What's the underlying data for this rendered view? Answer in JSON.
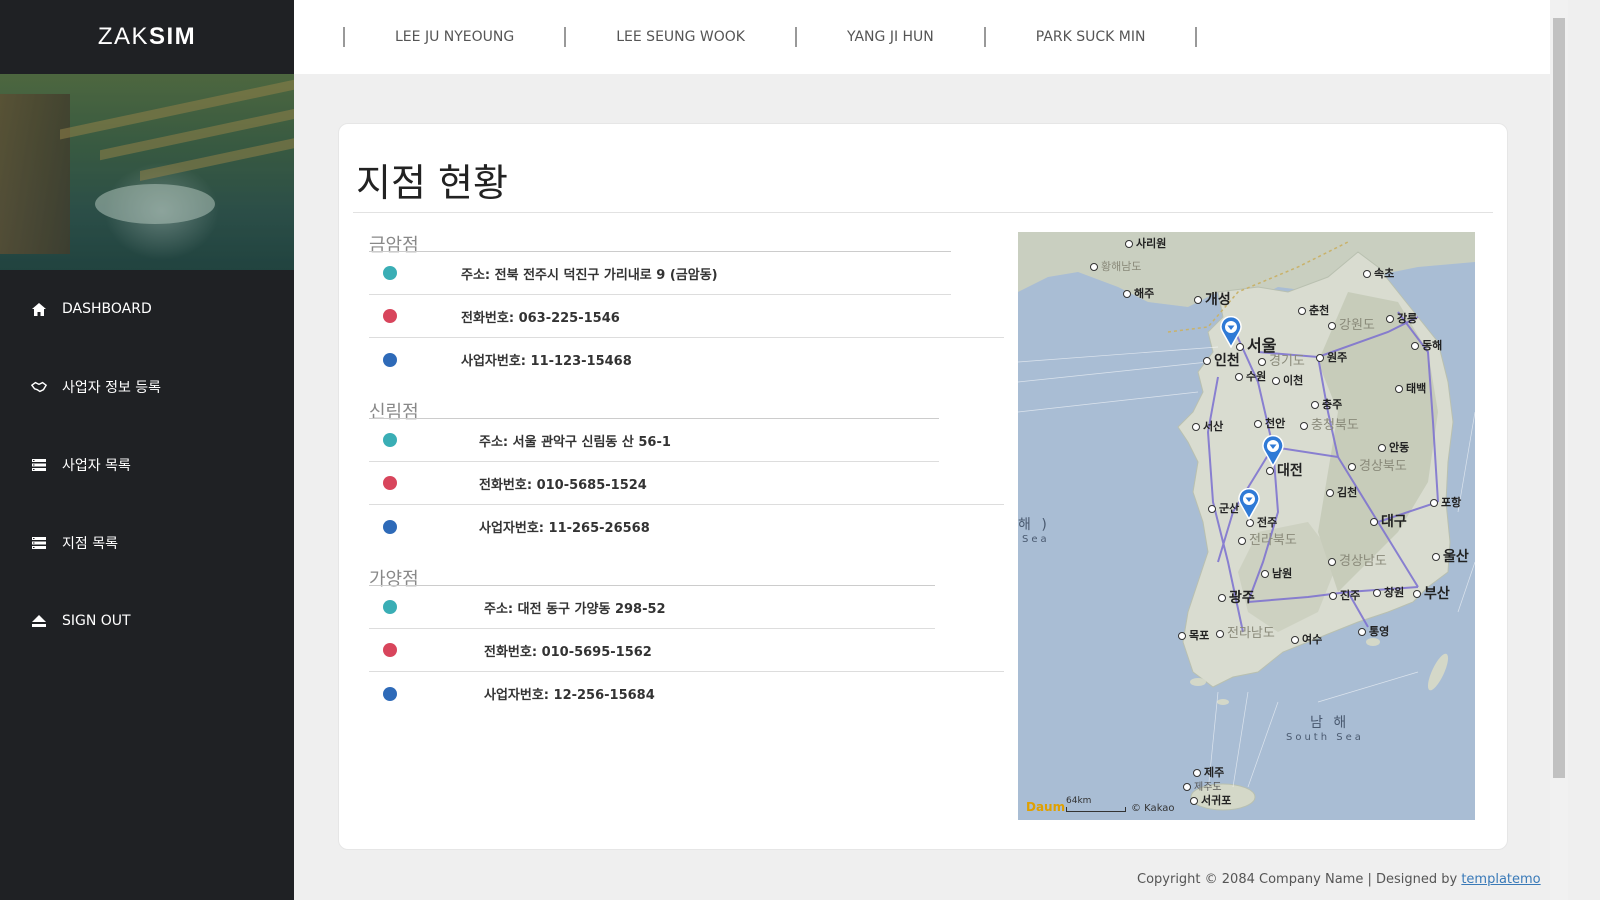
{
  "brand": {
    "light": "ZAK",
    "bold": "SIM"
  },
  "sidebar": {
    "items": [
      {
        "label": "DASHBOARD",
        "icon": "home-icon"
      },
      {
        "label": "사업자 정보 등록",
        "icon": "handshake-icon"
      },
      {
        "label": "사업자 목록",
        "icon": "list-icon"
      },
      {
        "label": "지점 목록",
        "icon": "list-icon"
      },
      {
        "label": "SIGN OUT",
        "icon": "eject-icon"
      }
    ]
  },
  "topnav": {
    "links": [
      "LEE JU NYEOUNG",
      "LEE SEUNG WOOK",
      "YANG JI HUN",
      "PARK SUCK MIN"
    ]
  },
  "main": {
    "title": "지점 현황",
    "branches": [
      {
        "name": "금암점",
        "address": "주소: 전북 전주시 덕진구 가리내로 9 (금암동)",
        "phone": "전화번호: 063-225-1546",
        "business_no": "사업자번호: 11-123-15468"
      },
      {
        "name": "신림점",
        "address": "주소: 서울 관악구 신림동 산 56-1",
        "phone": "전화번호: 010-5685-1524",
        "business_no": "사업자번호: 11-265-26568"
      },
      {
        "name": "가양점",
        "address": "주소: 대전 동구 가양동 298-52",
        "phone": "전화번호: 010-5695-1562",
        "business_no": "사업자번호: 12-256-15684"
      }
    ],
    "dot_colors": {
      "address": "#3aaeb5",
      "phone": "#d8455c",
      "business_no": "#2e6ab8"
    }
  },
  "map": {
    "cities": {
      "sariwon": "사리원",
      "hwanghae": "황해남도",
      "haeju": "해주",
      "kaesong": "개성",
      "chuncheon": "춘천",
      "sokcho": "속초",
      "gangneung": "강릉",
      "gangwon": "강원도",
      "donghae": "동해",
      "seoul": "서울",
      "incheon": "인천",
      "gyeonggi": "경기도",
      "wonju": "원주",
      "suwon": "수원",
      "icheon": "이천",
      "taebaek": "태백",
      "chungju": "충주",
      "cheonan": "천안",
      "seosan": "서산",
      "chungbuk": "충청북도",
      "andong": "안동",
      "daejeon": "대전",
      "gyeongbuk": "경상북도",
      "gimcheon": "김천",
      "pohang": "포항",
      "gunsan": "군산",
      "jeonju": "전주",
      "daegu": "대구",
      "jeonbuk": "전라북도",
      "ulsan": "울산",
      "namwon": "남원",
      "gyeongnam": "경상남도",
      "gwangju": "광주",
      "jinju": "진주",
      "changwon": "창원",
      "busan": "부산",
      "mokpo": "목포",
      "jeonnam": "전라남도",
      "yeosu": "여수",
      "tongyeong": "통영",
      "jeju": "제주",
      "seogwipo": "서귀포",
      "jejudo": "제주도"
    },
    "sea_west": "해 )",
    "sea_west_en": "Sea",
    "sea_south": "남 해",
    "sea_south_en": "South Sea",
    "brand": "Daum",
    "scale": "64km",
    "copyright": "© Kakao"
  },
  "footer": {
    "text": "Copyright © 2084 Company Name | Designed by ",
    "link": "templatemo"
  }
}
